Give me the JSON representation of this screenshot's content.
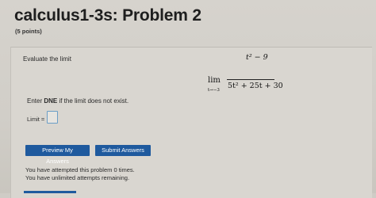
{
  "problem": {
    "title": "calculus1-3s: Problem 2",
    "points": "(5 points)"
  },
  "question": {
    "instruction": "Evaluate the limit",
    "limit_word": "lim",
    "limit_subscript": "t→−3",
    "numerator": "t² − 9",
    "denominator": "5t² + 25t + 30",
    "dne_prefix": "Enter ",
    "dne_keyword": "DNE",
    "dne_suffix": " if the limit does not exist."
  },
  "answer": {
    "label": "Limit =",
    "value": ""
  },
  "buttons": {
    "preview": "Preview My Answers",
    "submit": "Submit Answers"
  },
  "status": {
    "attempts": "You have attempted this problem 0 times.",
    "remaining": "You have unlimited attempts remaining."
  },
  "colors": {
    "button_bg": "#1f5a9e",
    "input_border": "#6b9ec7"
  }
}
